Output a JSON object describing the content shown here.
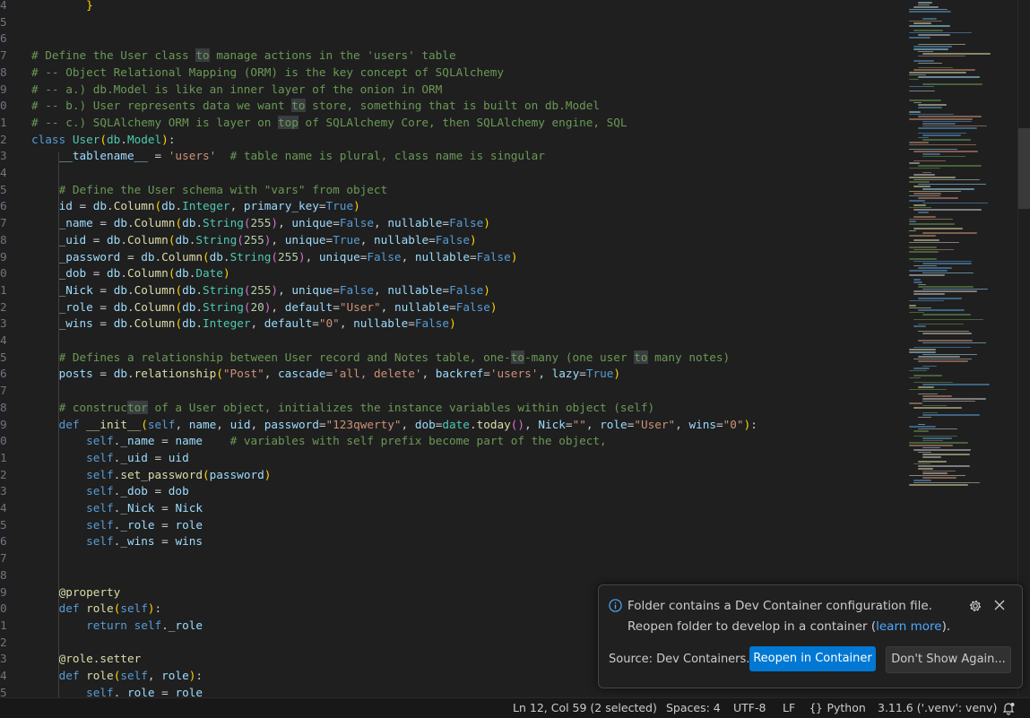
{
  "editor": {
    "lines": [
      {
        "n": "4",
        "html": "        <span class='br'>}</span>"
      },
      {
        "n": "5",
        "html": ""
      },
      {
        "n": "6",
        "html": ""
      },
      {
        "n": "7",
        "html": "<span class='cm'># Define the User class <span class='hl'>to</span> manage actions in the 'users' table</span>"
      },
      {
        "n": "8",
        "html": "<span class='cm'># -- Object Relational Mapping (ORM) is the key concept of SQLAlchemy</span>"
      },
      {
        "n": "9",
        "html": "<span class='cm'># -- a.) db.Model is like an inner layer of the onion in ORM</span>"
      },
      {
        "n": "0",
        "html": "<span class='cm'># -- b.) User represents data we want <span class='hl'>to</span> store, something that is built on db.Model</span>"
      },
      {
        "n": "1",
        "html": "<span class='cm'># -- c.) SQLAlchemy ORM is layer on <span class='hl'>top</span> of SQLAlchemy Core, then SQLAlchemy engine, SQL</span>"
      },
      {
        "n": "2",
        "html": "<span class='kw'>class</span> <span class='cls'>User</span><span class='br'>(</span><span class='cls'>db</span>.<span class='cls'>Model</span><span class='br'>)</span>:"
      },
      {
        "n": "3",
        "html": "    <span class='var'>__tablename__</span> = <span class='str'>'users'</span>  <span class='cm'># table name is plural, class name is singular</span>"
      },
      {
        "n": "4",
        "html": ""
      },
      {
        "n": "5",
        "html": "    <span class='cm'># Define the User schema with \"vars\" from object</span>"
      },
      {
        "n": "6",
        "html": "    <span class='var'>id</span> = <span class='var'>db</span>.<span class='fn'>Column</span><span class='br'>(</span><span class='var'>db</span>.<span class='cls'>Integer</span>, <span class='var'>primary_key</span>=<span class='kw'>True</span><span class='br'>)</span>"
      },
      {
        "n": "7",
        "html": "    <span class='var'>_name</span> = <span class='var'>db</span>.<span class='fn'>Column</span><span class='br'>(</span><span class='var'>db</span>.<span class='cls'>String</span><span class='br2'>(</span><span class='num'>255</span><span class='br2'>)</span>, <span class='var'>unique</span>=<span class='kw'>False</span>, <span class='var'>nullable</span>=<span class='kw'>False</span><span class='br'>)</span>"
      },
      {
        "n": "8",
        "html": "    <span class='var'>_uid</span> = <span class='var'>db</span>.<span class='fn'>Column</span><span class='br'>(</span><span class='var'>db</span>.<span class='cls'>String</span><span class='br2'>(</span><span class='num'>255</span><span class='br2'>)</span>, <span class='var'>unique</span>=<span class='kw'>True</span>, <span class='var'>nullable</span>=<span class='kw'>False</span><span class='br'>)</span>"
      },
      {
        "n": "9",
        "html": "    <span class='var'>_password</span> = <span class='var'>db</span>.<span class='fn'>Column</span><span class='br'>(</span><span class='var'>db</span>.<span class='cls'>String</span><span class='br2'>(</span><span class='num'>255</span><span class='br2'>)</span>, <span class='var'>unique</span>=<span class='kw'>False</span>, <span class='var'>nullable</span>=<span class='kw'>False</span><span class='br'>)</span>"
      },
      {
        "n": "0",
        "html": "    <span class='var'>_dob</span> = <span class='var'>db</span>.<span class='fn'>Column</span><span class='br'>(</span><span class='var'>db</span>.<span class='cls'>Date</span><span class='br'>)</span>"
      },
      {
        "n": "1",
        "html": "    <span class='var'>_Nick</span> = <span class='var'>db</span>.<span class='fn'>Column</span><span class='br'>(</span><span class='var'>db</span>.<span class='cls'>String</span><span class='br2'>(</span><span class='num'>255</span><span class='br2'>)</span>, <span class='var'>unique</span>=<span class='kw'>False</span>, <span class='var'>nullable</span>=<span class='kw'>False</span><span class='br'>)</span>"
      },
      {
        "n": "2",
        "html": "    <span class='var'>_role</span> = <span class='var'>db</span>.<span class='fn'>Column</span><span class='br'>(</span><span class='var'>db</span>.<span class='cls'>String</span><span class='br2'>(</span><span class='num'>20</span><span class='br2'>)</span>, <span class='var'>default</span>=<span class='str'>\"User\"</span>, <span class='var'>nullable</span>=<span class='kw'>False</span><span class='br'>)</span>"
      },
      {
        "n": "3",
        "html": "    <span class='var'>_wins</span> = <span class='var'>db</span>.<span class='fn'>Column</span><span class='br'>(</span><span class='var'>db</span>.<span class='cls'>Integer</span>, <span class='var'>default</span>=<span class='str'>\"0\"</span>, <span class='var'>nullable</span>=<span class='kw'>False</span><span class='br'>)</span>"
      },
      {
        "n": "4",
        "html": ""
      },
      {
        "n": "5",
        "html": "    <span class='cm'># Defines a relationship between User record and Notes table, one-<span class='hl'>to</span>-many (one user <span class='hl'>to</span> many notes)</span>"
      },
      {
        "n": "6",
        "html": "    <span class='var'>posts</span> = <span class='var'>db</span>.<span class='fn'>relationship</span><span class='br'>(</span><span class='str'>\"Post\"</span>, <span class='var'>cascade</span>=<span class='str'>'all, delete'</span>, <span class='var'>backref</span>=<span class='str'>'users'</span>, <span class='var'>lazy</span>=<span class='kw'>True</span><span class='br'>)</span>"
      },
      {
        "n": "7",
        "html": ""
      },
      {
        "n": "8",
        "html": "    <span class='cm'># construc<span class='hl'>tor</span> of a User object, initializes the instance variables within object (self)</span>"
      },
      {
        "n": "9",
        "html": "    <span class='kw'>def</span> <span class='fn'>__init__</span><span class='br'>(</span><span class='self'>self</span>, <span class='var'>name</span>, <span class='var'>uid</span>, <span class='var'>password</span>=<span class='str'>\"123qwerty\"</span>, <span class='var'>dob</span>=<span class='cls'>date</span>.<span class='fn'>today</span><span class='br2'>()</span>, <span class='var'>Nick</span>=<span class='str'>\"\"</span>, <span class='var'>role</span>=<span class='str'>\"User\"</span>, <span class='var'>wins</span>=<span class='str'>\"0\"</span><span class='br'>)</span>:"
      },
      {
        "n": "0",
        "html": "        <span class='self'>self</span>.<span class='var'>_name</span> = <span class='var'>name</span>    <span class='cm'># variables with self prefix become part of the object,</span>"
      },
      {
        "n": "1",
        "html": "        <span class='self'>self</span>.<span class='var'>_uid</span> = <span class='var'>uid</span>"
      },
      {
        "n": "2",
        "html": "        <span class='self'>self</span>.<span class='fn'>set_password</span><span class='br'>(</span><span class='var'>password</span><span class='br'>)</span>"
      },
      {
        "n": "3",
        "html": "        <span class='self'>self</span>.<span class='var'>_dob</span> = <span class='var'>dob</span>"
      },
      {
        "n": "4",
        "html": "        <span class='self'>self</span>.<span class='var'>_Nick</span> = <span class='var'>Nick</span>"
      },
      {
        "n": "5",
        "html": "        <span class='self'>self</span>.<span class='var'>_role</span> = <span class='var'>role</span>"
      },
      {
        "n": "6",
        "html": "        <span class='self'>self</span>.<span class='var'>_wins</span> = <span class='var'>wins</span>"
      },
      {
        "n": "7",
        "html": ""
      },
      {
        "n": "8",
        "html": ""
      },
      {
        "n": "9",
        "html": "    <span class='dec'>@property</span>"
      },
      {
        "n": "0",
        "html": "    <span class='kw'>def</span> <span class='fn'>role</span><span class='br'>(</span><span class='self'>self</span><span class='br'>)</span>:"
      },
      {
        "n": "1",
        "html": "        <span class='kw'>return</span> <span class='self'>self</span>.<span class='var'>_role</span>"
      },
      {
        "n": "2",
        "html": ""
      },
      {
        "n": "3",
        "html": "    <span class='dec'>@role.setter</span>"
      },
      {
        "n": "4",
        "html": "    <span class='kw'>def</span> <span class='fn'>role</span><span class='br'>(</span><span class='self'>self</span>, <span class='var'>role</span><span class='br'>)</span>:"
      },
      {
        "n": "5",
        "html": "        <span class='self'>self</span>.<span class='var'>_role</span> = <span class='var'>role</span>"
      }
    ]
  },
  "statusbar": {
    "cursor": "Ln 12, Col 59 (2 selected)",
    "spaces": "Spaces: 4",
    "encoding": "UTF-8",
    "eol": "LF",
    "language": "Python",
    "interpreter": "3.11.6 ('.venv': venv)"
  },
  "notification": {
    "message_part1": "Folder contains a Dev Container configuration file. Reopen folder to develop in a container (",
    "link": "learn more",
    "message_part2": ").",
    "source": "Source: Dev Containers...",
    "primary_button": "Reopen in Container",
    "secondary_button": "Don't Show Again..."
  },
  "colors": {
    "accent": "#0078d4",
    "background": "#1f1f1f",
    "link": "#4daafc"
  }
}
